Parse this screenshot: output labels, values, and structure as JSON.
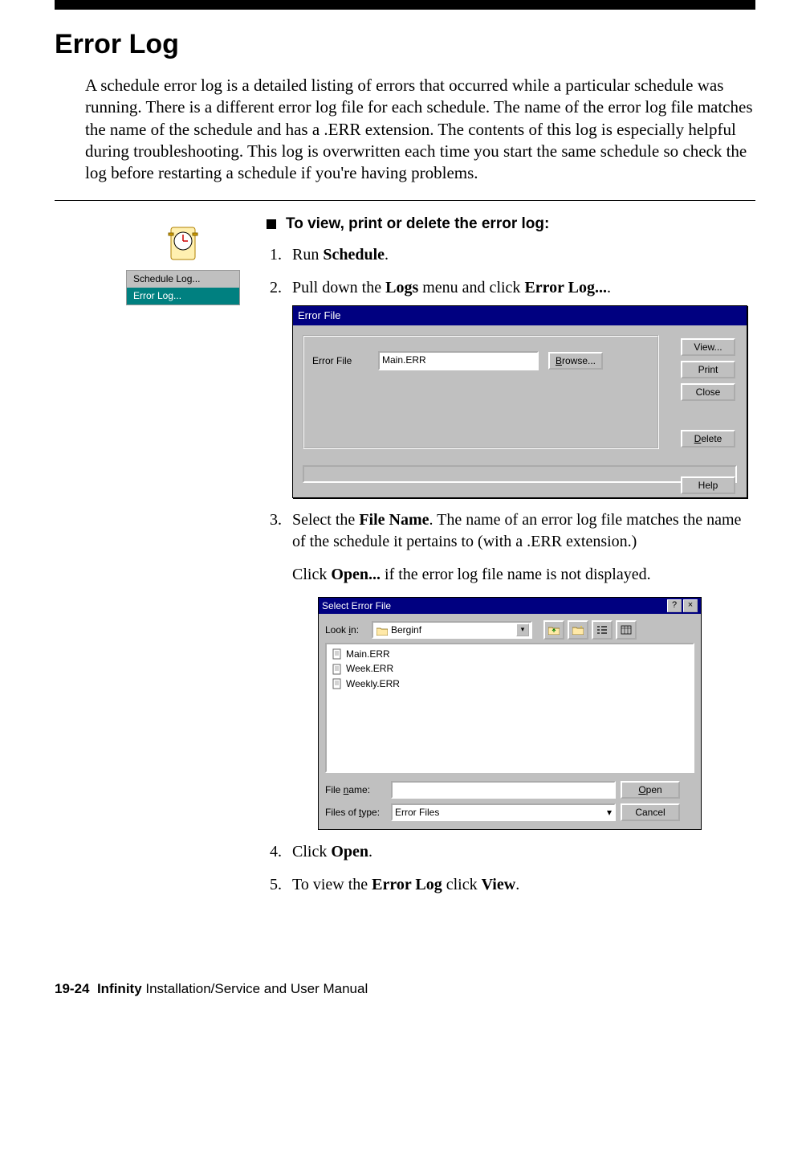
{
  "title": "Error Log",
  "intro": "A schedule error log is a detailed listing of errors that occurred while a particular schedule was running. There is a different error log file for each schedule. The name of the error log file matches the name of the schedule and has a .ERR extension. The contents of this log is especially helpful during troubleshooting. This log is overwritten each time you start the same schedule so check the log before restarting a schedule if you're having problems.",
  "task_heading": "To view, print or delete the error log:",
  "menu": {
    "item1": "Schedule Log...",
    "item2": "Error Log..."
  },
  "steps": {
    "s1_a": "Run ",
    "s1_b": "Schedule",
    "s1_c": ".",
    "s2_a": "Pull down the ",
    "s2_b": "Logs",
    "s2_c": " menu and click ",
    "s2_d": "Error Log...",
    "s2_e": ".",
    "s3_a": "Select the ",
    "s3_b": "File Name",
    "s3_c": ". The name of an error log file matches the name of the schedule it pertains to (with a .ERR extension.)",
    "s3_sub_a": "Click ",
    "s3_sub_b": "Open...",
    "s3_sub_c": " if the error log file name is not displayed.",
    "s4_a": "Click ",
    "s4_b": "Open",
    "s4_c": ".",
    "s5_a": "To view the ",
    "s5_b": "Error Log",
    "s5_c": " click ",
    "s5_d": "View",
    "s5_e": "."
  },
  "dlg1": {
    "title": "Error File",
    "label": "Error File",
    "value": "Main.ERR",
    "browse": "Browse...",
    "view": "View...",
    "print": "Print",
    "close": "Close",
    "delete": "Delete",
    "help": "Help"
  },
  "dlg2": {
    "title": "Select Error File",
    "lookin_label": "Look in:",
    "lookin_value": "Berginf",
    "files": [
      "Main.ERR",
      "Week.ERR",
      "Weekly.ERR"
    ],
    "filename_label": "File name:",
    "filename_value": "",
    "filetype_label": "Files of type:",
    "filetype_value": "Error Files",
    "open": "Open",
    "cancel": "Cancel"
  },
  "footer": {
    "pagenum": "19-24",
    "product": "Infinity",
    "rest": " Installation/Service and User Manual"
  }
}
